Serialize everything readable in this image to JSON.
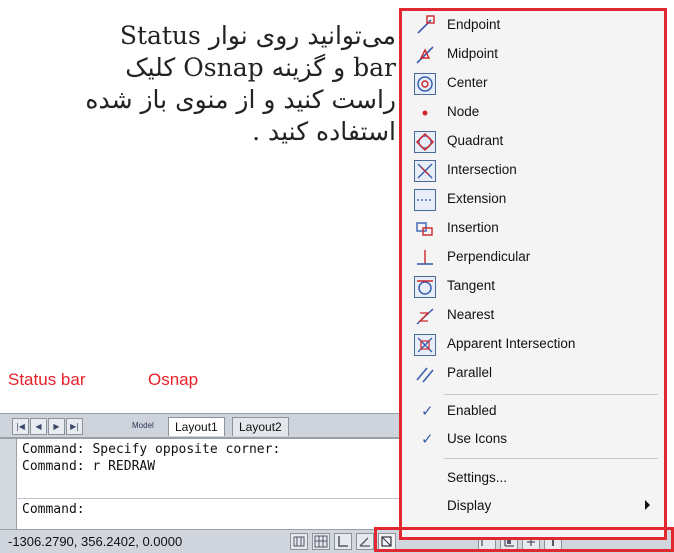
{
  "paragraph": {
    "line1": "می‌توانید روی نوار Status",
    "line2": "bar و گزینه Osnap کلیک",
    "line3": "راست کنید و از منوی باز شده",
    "line4": "استفاده کنید ."
  },
  "callouts": {
    "status_bar": "Status bar",
    "osnap": "Osnap"
  },
  "layout_tabs": {
    "model": "Model",
    "layout1": "Layout1",
    "layout2": "Layout2"
  },
  "command_lines": [
    "Command: Specify opposite corner:",
    "Command: r REDRAW",
    "Command:"
  ],
  "statusbar": {
    "coordinates": "-1306.2790, 356.2402, 0.0000"
  },
  "menu": {
    "items": [
      {
        "label": "Endpoint",
        "icon": "endpoint-icon"
      },
      {
        "label": "Midpoint",
        "icon": "midpoint-icon"
      },
      {
        "label": "Center",
        "icon": "center-icon"
      },
      {
        "label": "Node",
        "icon": "node-icon"
      },
      {
        "label": "Quadrant",
        "icon": "quadrant-icon"
      },
      {
        "label": "Intersection",
        "icon": "intersection-icon"
      },
      {
        "label": "Extension",
        "icon": "extension-icon"
      },
      {
        "label": "Insertion",
        "icon": "insertion-icon"
      },
      {
        "label": "Perpendicular",
        "icon": "perpendicular-icon"
      },
      {
        "label": "Tangent",
        "icon": "tangent-icon"
      },
      {
        "label": "Nearest",
        "icon": "nearest-icon"
      },
      {
        "label": "Apparent Intersection",
        "icon": "apparent-intersection-icon"
      },
      {
        "label": "Parallel",
        "icon": "parallel-icon"
      }
    ],
    "enabled": {
      "label": "Enabled",
      "checked": true
    },
    "use_icons": {
      "label": "Use Icons",
      "checked": true
    },
    "settings": {
      "label": "Settings..."
    },
    "display": {
      "label": "Display"
    }
  },
  "colors": {
    "highlight": "#e12830",
    "callout": "#e8202a",
    "icon_blue": "#3a5fb0",
    "icon_red": "#d0262c"
  }
}
